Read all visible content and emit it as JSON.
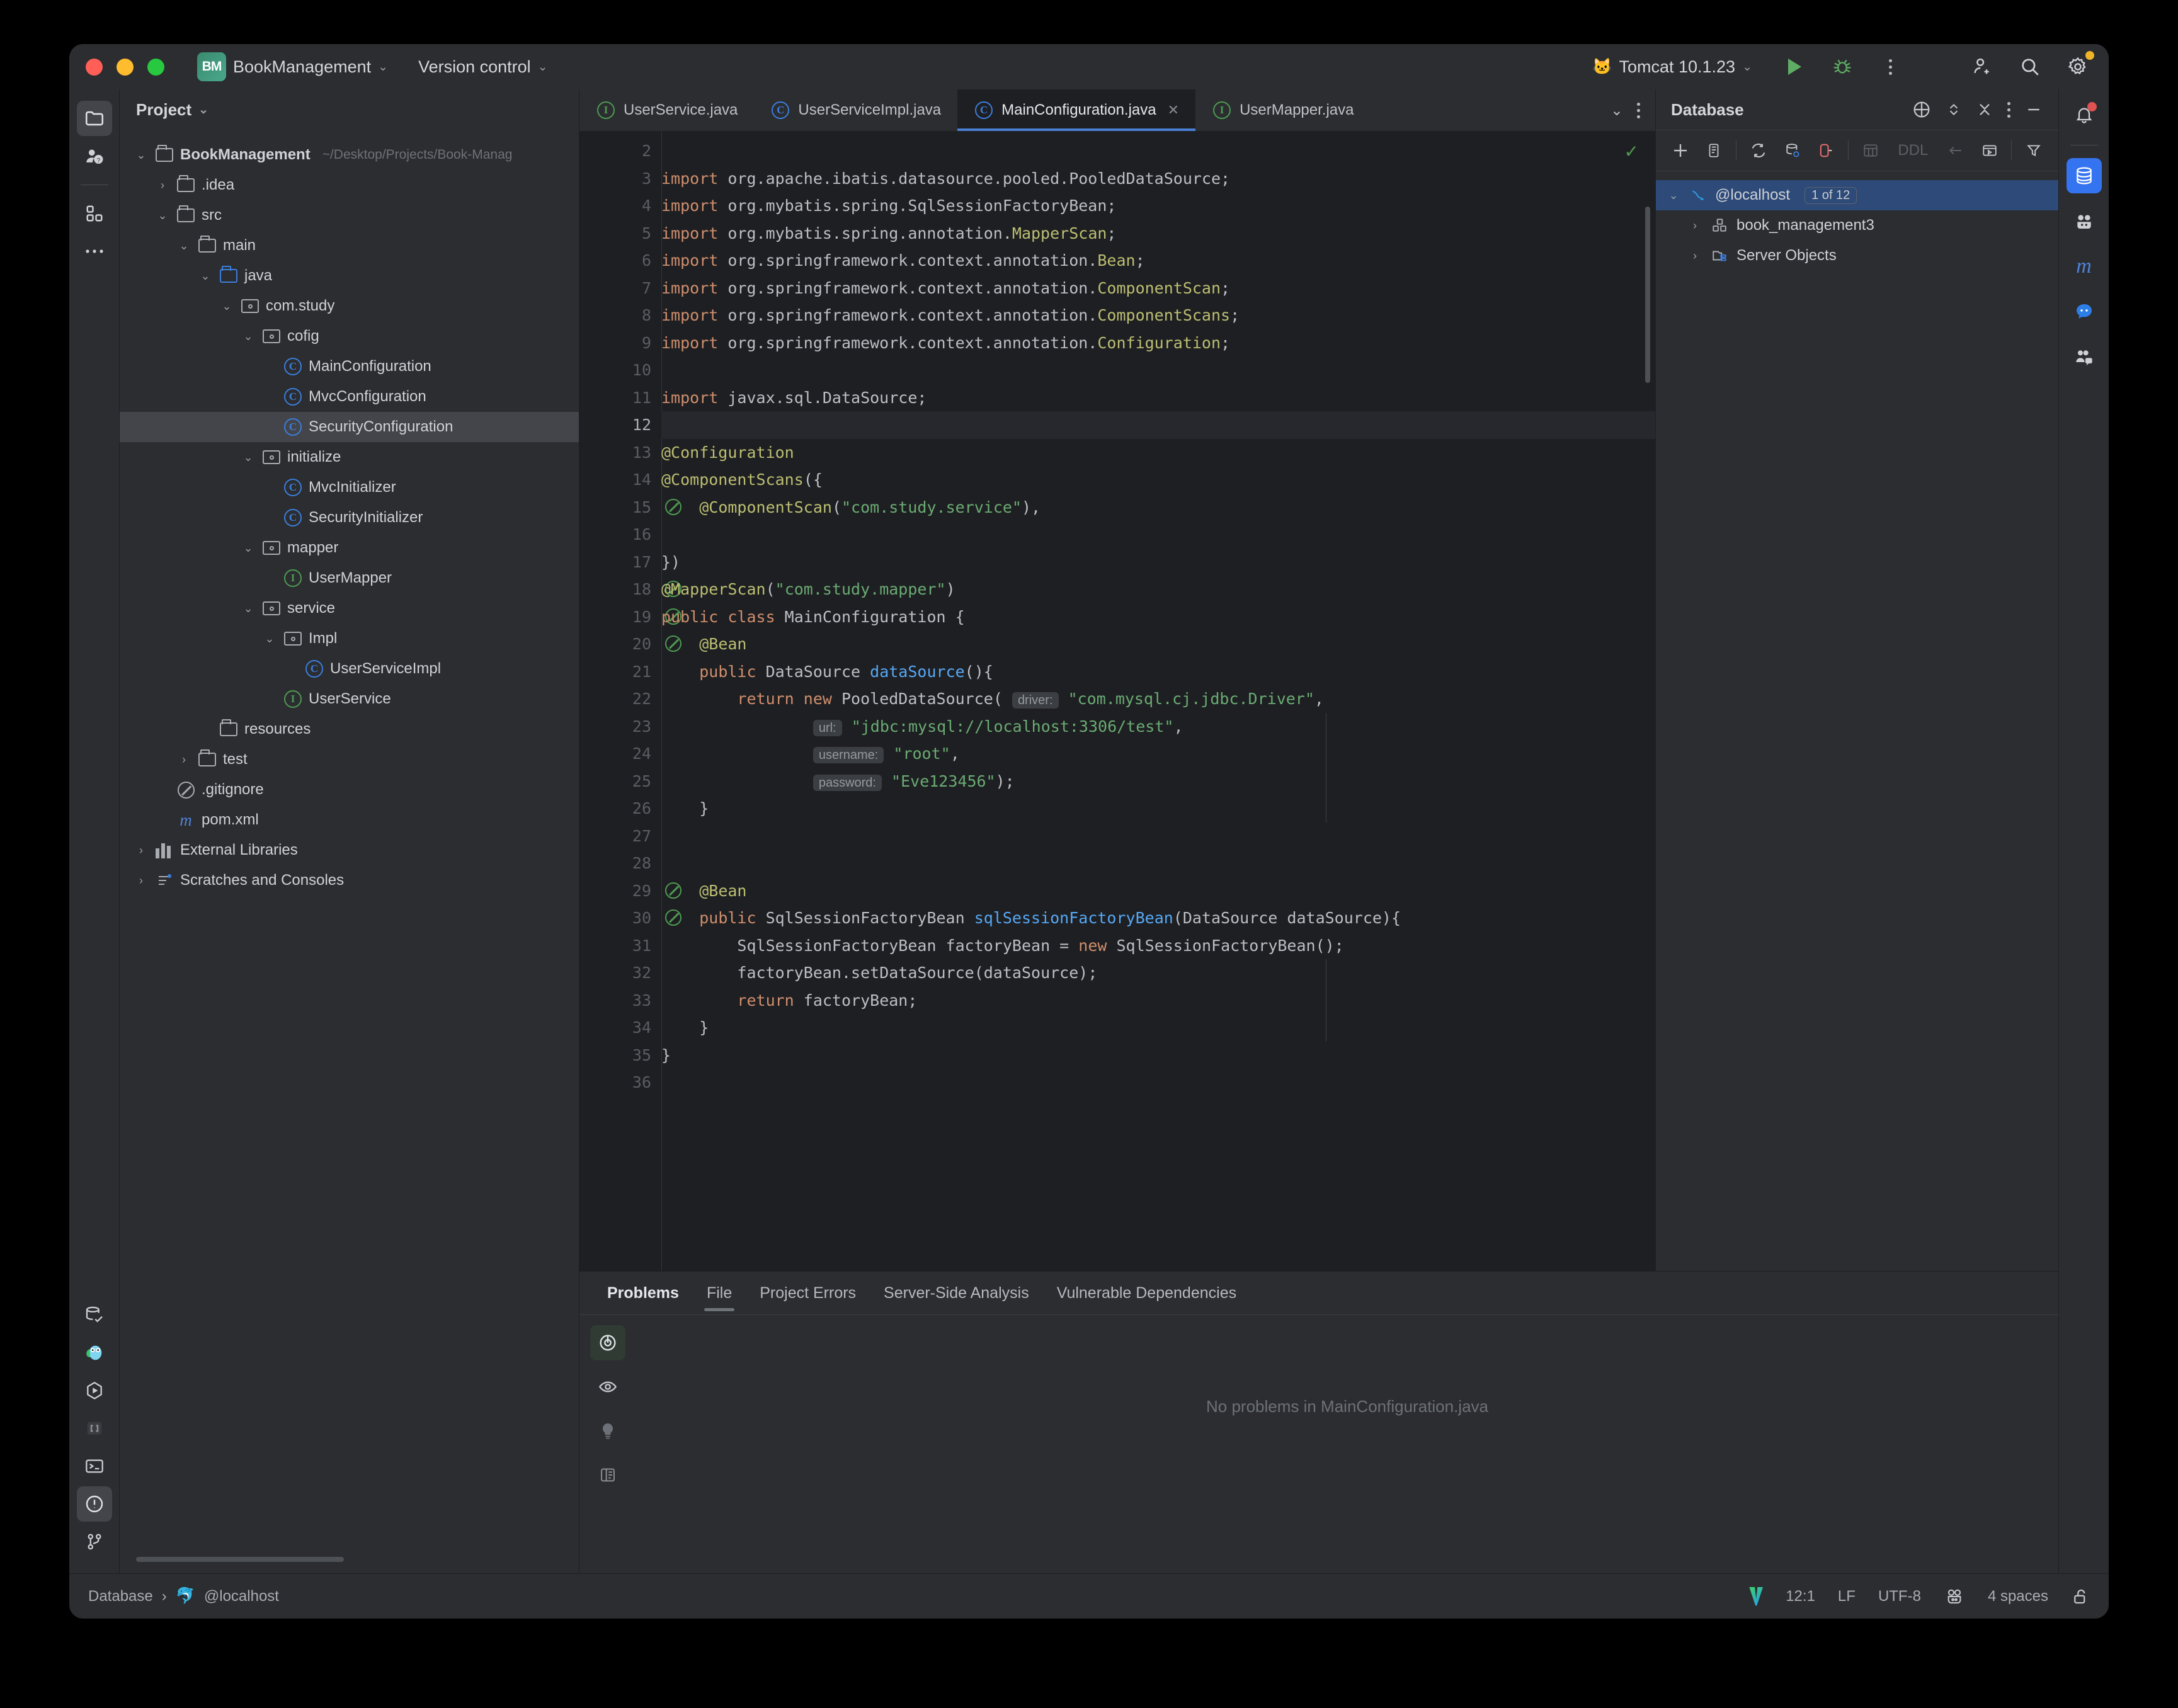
{
  "titlebar": {
    "project_badge": "BM",
    "project_name": "BookManagement",
    "version_control": "Version control",
    "run_config": "Tomcat 10.1.23",
    "icons": {
      "run": "run-icon",
      "debug": "debug-icon",
      "more": "more-options-icon",
      "add_user": "add-user-icon",
      "search": "search-icon",
      "settings": "settings-icon"
    }
  },
  "left_rail": {
    "top": [
      {
        "name": "project-tool-icon",
        "label": "Project"
      },
      {
        "name": "ai-assistant-icon",
        "label": "AI Assistant"
      },
      {
        "name": "structure-icon",
        "label": "Structure"
      },
      {
        "name": "more-tools-icon",
        "label": "More tools"
      }
    ],
    "bottom": [
      {
        "name": "database-check-icon",
        "label": "Database"
      },
      {
        "name": "go-gopher-icon",
        "label": "Gopher"
      },
      {
        "name": "run-hex-icon",
        "label": "Run"
      },
      {
        "name": "brackets-icon",
        "label": "Endpoints"
      },
      {
        "name": "terminal-icon",
        "label": "Terminal"
      },
      {
        "name": "problems-icon",
        "label": "Problems"
      },
      {
        "name": "git-branch-icon",
        "label": "Version Control"
      }
    ]
  },
  "right_rail": [
    {
      "name": "notifications-icon",
      "label": "Notifications"
    },
    {
      "name": "database-icon",
      "label": "Database"
    },
    {
      "name": "gradle-icon",
      "label": "Gradle"
    },
    {
      "name": "maven-icon",
      "label": "Maven"
    },
    {
      "name": "chat-icon",
      "label": "Chat"
    },
    {
      "name": "code-with-me-icon",
      "label": "Code With Me"
    }
  ],
  "project_panel": {
    "title": "Project",
    "tree": [
      {
        "depth": 0,
        "arrow": "down",
        "icon": "module-folder-icon",
        "label": "BookManagement",
        "bold": true,
        "suffix": "~/Desktop/Projects/Book-Manag"
      },
      {
        "depth": 1,
        "arrow": "right",
        "icon": "folder-icon",
        "label": ".idea"
      },
      {
        "depth": 1,
        "arrow": "down",
        "icon": "folder-icon",
        "label": "src"
      },
      {
        "depth": 2,
        "arrow": "down",
        "icon": "folder-icon",
        "label": "main"
      },
      {
        "depth": 3,
        "arrow": "down",
        "icon": "source-folder-icon",
        "label": "java"
      },
      {
        "depth": 4,
        "arrow": "down",
        "icon": "package-icon",
        "label": "com.study"
      },
      {
        "depth": 5,
        "arrow": "down",
        "icon": "package-icon",
        "label": "cofig"
      },
      {
        "depth": 6,
        "arrow": "none",
        "icon": "class-icon",
        "label": "MainConfiguration"
      },
      {
        "depth": 6,
        "arrow": "none",
        "icon": "class-icon",
        "label": "MvcConfiguration"
      },
      {
        "depth": 6,
        "arrow": "none",
        "icon": "class-icon",
        "label": "SecurityConfiguration",
        "selected": true
      },
      {
        "depth": 5,
        "arrow": "down",
        "icon": "package-icon",
        "label": "initialize"
      },
      {
        "depth": 6,
        "arrow": "none",
        "icon": "class-icon",
        "label": "MvcInitializer"
      },
      {
        "depth": 6,
        "arrow": "none",
        "icon": "class-icon",
        "label": "SecurityInitializer"
      },
      {
        "depth": 5,
        "arrow": "down",
        "icon": "package-icon",
        "label": "mapper"
      },
      {
        "depth": 6,
        "arrow": "none",
        "icon": "interface-icon",
        "label": "UserMapper"
      },
      {
        "depth": 5,
        "arrow": "down",
        "icon": "package-icon",
        "label": "service"
      },
      {
        "depth": 6,
        "arrow": "down",
        "icon": "package-icon",
        "label": "Impl"
      },
      {
        "depth": 7,
        "arrow": "none",
        "icon": "class-icon",
        "label": "UserServiceImpl"
      },
      {
        "depth": 6,
        "arrow": "none",
        "icon": "interface-icon",
        "label": "UserService"
      },
      {
        "depth": 3,
        "arrow": "none",
        "icon": "resources-folder-icon",
        "label": "resources"
      },
      {
        "depth": 2,
        "arrow": "right",
        "icon": "folder-icon",
        "label": "test"
      },
      {
        "depth": 1,
        "arrow": "none",
        "icon": "gitignore-icon",
        "label": ".gitignore"
      },
      {
        "depth": 1,
        "arrow": "none",
        "icon": "maven-icon",
        "label": "pom.xml"
      },
      {
        "depth": 0,
        "arrow": "right",
        "icon": "libraries-icon",
        "label": "External Libraries"
      },
      {
        "depth": 0,
        "arrow": "right",
        "icon": "scratches-icon",
        "label": "Scratches and Consoles"
      }
    ]
  },
  "editor": {
    "tabs": [
      {
        "label": "UserService.java",
        "icon": "interface-icon",
        "active": false
      },
      {
        "label": "UserServiceImpl.java",
        "icon": "class-icon",
        "active": false
      },
      {
        "label": "MainConfiguration.java",
        "icon": "class-icon",
        "active": true,
        "closable": true
      },
      {
        "label": "UserMapper.java",
        "icon": "interface-icon",
        "active": false
      }
    ],
    "tab_overflow_icon": "chevron-down-icon",
    "tab_options_icon": "more-options-icon",
    "inspection_status_icon": "no-errors-check-icon",
    "first_line_number": 2,
    "current_line": 12,
    "lines": [
      {
        "n": 2,
        "segments": []
      },
      {
        "n": 3,
        "segments": [
          {
            "t": "import ",
            "c": "k"
          },
          {
            "t": "org.apache.ibatis.datasource.pooled.PooledDataSource;",
            "c": "p"
          }
        ]
      },
      {
        "n": 4,
        "segments": [
          {
            "t": "import ",
            "c": "k"
          },
          {
            "t": "org.mybatis.spring.SqlSessionFactoryBean;",
            "c": "p"
          }
        ]
      },
      {
        "n": 5,
        "segments": [
          {
            "t": "import ",
            "c": "k"
          },
          {
            "t": "org.mybatis.spring.annotation.",
            "c": "p"
          },
          {
            "t": "MapperScan",
            "c": "a"
          },
          {
            "t": ";",
            "c": "p"
          }
        ]
      },
      {
        "n": 6,
        "segments": [
          {
            "t": "import ",
            "c": "k"
          },
          {
            "t": "org.springframework.context.annotation.",
            "c": "p"
          },
          {
            "t": "Bean",
            "c": "a"
          },
          {
            "t": ";",
            "c": "p"
          }
        ]
      },
      {
        "n": 7,
        "segments": [
          {
            "t": "import ",
            "c": "k"
          },
          {
            "t": "org.springframework.context.annotation.",
            "c": "p"
          },
          {
            "t": "ComponentScan",
            "c": "a"
          },
          {
            "t": ";",
            "c": "p"
          }
        ]
      },
      {
        "n": 8,
        "segments": [
          {
            "t": "import ",
            "c": "k"
          },
          {
            "t": "org.springframework.context.annotation.",
            "c": "p"
          },
          {
            "t": "ComponentScans",
            "c": "a"
          },
          {
            "t": ";",
            "c": "p"
          }
        ]
      },
      {
        "n": 9,
        "segments": [
          {
            "t": "import ",
            "c": "k"
          },
          {
            "t": "org.springframework.context.annotation.",
            "c": "p"
          },
          {
            "t": "Configuration",
            "c": "a"
          },
          {
            "t": ";",
            "c": "p"
          }
        ]
      },
      {
        "n": 10,
        "segments": []
      },
      {
        "n": 11,
        "segments": [
          {
            "t": "import ",
            "c": "k"
          },
          {
            "t": "javax.sql.DataSource;",
            "c": "p"
          }
        ]
      },
      {
        "n": 12,
        "segments": []
      },
      {
        "n": 13,
        "segments": [
          {
            "t": "@Configuration",
            "c": "a"
          }
        ]
      },
      {
        "n": 14,
        "segments": [
          {
            "t": "@ComponentScans",
            "c": "a"
          },
          {
            "t": "({",
            "c": "p"
          }
        ]
      },
      {
        "n": 15,
        "gutter_icon": "bean-search-icon",
        "segments": [
          {
            "t": "    ",
            "c": "p"
          },
          {
            "t": "@ComponentScan",
            "c": "a"
          },
          {
            "t": "(",
            "c": "p"
          },
          {
            "t": "\"com.study.service\"",
            "c": "s"
          },
          {
            "t": "),",
            "c": "p"
          }
        ]
      },
      {
        "n": 16,
        "segments": []
      },
      {
        "n": 17,
        "segments": [
          {
            "t": "})",
            "c": "p"
          }
        ]
      },
      {
        "n": 18,
        "gutter_icon": "bean-search-icon",
        "segments": [
          {
            "t": "@MapperScan",
            "c": "a"
          },
          {
            "t": "(",
            "c": "p"
          },
          {
            "t": "\"com.study.mapper\"",
            "c": "s"
          },
          {
            "t": ")",
            "c": "p"
          }
        ]
      },
      {
        "n": 19,
        "gutter_icon": "bean-icon",
        "segments": [
          {
            "t": "public class ",
            "c": "k"
          },
          {
            "t": "MainConfiguration {",
            "c": "p"
          }
        ]
      },
      {
        "n": 20,
        "gutter_icon": "bean-nav-icon",
        "segments": [
          {
            "t": "    ",
            "c": "p"
          },
          {
            "t": "@Bean",
            "c": "a"
          }
        ]
      },
      {
        "n": 21,
        "segments": [
          {
            "t": "    ",
            "c": "p"
          },
          {
            "t": "public ",
            "c": "k"
          },
          {
            "t": "DataSource ",
            "c": "p"
          },
          {
            "t": "dataSource",
            "c": "m"
          },
          {
            "t": "(){",
            "c": "p"
          }
        ]
      },
      {
        "n": 22,
        "segments": [
          {
            "t": "        ",
            "c": "p"
          },
          {
            "t": "return new ",
            "c": "k"
          },
          {
            "t": "PooledDataSource( ",
            "c": "p"
          },
          {
            "t": "driver:",
            "c": "hint"
          },
          {
            "t": " ",
            "c": "p"
          },
          {
            "t": "\"com.mysql.cj.jdbc.Driver\"",
            "c": "s"
          },
          {
            "t": ",",
            "c": "p"
          }
        ]
      },
      {
        "n": 23,
        "segments": [
          {
            "t": "                ",
            "c": "p"
          },
          {
            "t": "url:",
            "c": "hint"
          },
          {
            "t": " ",
            "c": "p"
          },
          {
            "t": "\"jdbc:mysql://localhost:3306/test\"",
            "c": "s"
          },
          {
            "t": ",",
            "c": "p"
          }
        ]
      },
      {
        "n": 24,
        "segments": [
          {
            "t": "                ",
            "c": "p"
          },
          {
            "t": "username:",
            "c": "hint"
          },
          {
            "t": " ",
            "c": "p"
          },
          {
            "t": "\"root\"",
            "c": "s"
          },
          {
            "t": ",",
            "c": "p"
          }
        ]
      },
      {
        "n": 25,
        "segments": [
          {
            "t": "                ",
            "c": "p"
          },
          {
            "t": "password:",
            "c": "hint"
          },
          {
            "t": " ",
            "c": "p"
          },
          {
            "t": "\"Eve123456\"",
            "c": "s"
          },
          {
            "t": ");",
            "c": "p"
          }
        ]
      },
      {
        "n": 26,
        "segments": [
          {
            "t": "    }",
            "c": "p"
          }
        ]
      },
      {
        "n": 27,
        "segments": []
      },
      {
        "n": 28,
        "segments": []
      },
      {
        "n": 29,
        "gutter_icon": "bean-nav-icon",
        "segments": [
          {
            "t": "    ",
            "c": "p"
          },
          {
            "t": "@Bean",
            "c": "a"
          }
        ]
      },
      {
        "n": 30,
        "gutter_icon": "bean-out-icon",
        "segments": [
          {
            "t": "    ",
            "c": "p"
          },
          {
            "t": "public ",
            "c": "k"
          },
          {
            "t": "SqlSessionFactoryBean ",
            "c": "p"
          },
          {
            "t": "sqlSessionFactoryBean",
            "c": "m"
          },
          {
            "t": "(DataSource dataSource){",
            "c": "p"
          }
        ]
      },
      {
        "n": 31,
        "segments": [
          {
            "t": "        ",
            "c": "p"
          },
          {
            "t": "SqlSessionFactoryBean factoryBean = ",
            "c": "p"
          },
          {
            "t": "new ",
            "c": "k"
          },
          {
            "t": "SqlSessionFactoryBean();",
            "c": "p"
          }
        ]
      },
      {
        "n": 32,
        "segments": [
          {
            "t": "        ",
            "c": "p"
          },
          {
            "t": "factoryBean.setDataSource(dataSource);",
            "c": "p"
          }
        ]
      },
      {
        "n": 33,
        "segments": [
          {
            "t": "        ",
            "c": "p"
          },
          {
            "t": "return ",
            "c": "k"
          },
          {
            "t": "factoryBean;",
            "c": "p"
          }
        ]
      },
      {
        "n": 34,
        "segments": [
          {
            "t": "    }",
            "c": "p"
          }
        ]
      },
      {
        "n": 35,
        "segments": [
          {
            "t": "}",
            "c": "p"
          }
        ]
      },
      {
        "n": 36,
        "segments": []
      }
    ]
  },
  "database_panel": {
    "title": "Database",
    "header_icons": [
      {
        "name": "locate-icon"
      },
      {
        "name": "expand-collapse-icon"
      },
      {
        "name": "collapse-all-icon"
      },
      {
        "name": "more-options-icon"
      },
      {
        "name": "minimize-icon"
      }
    ],
    "toolbar": [
      {
        "name": "add-data-source-icon",
        "label": "+"
      },
      {
        "name": "duplicate-icon",
        "label": ""
      },
      {
        "name": "refresh-icon",
        "label": ""
      },
      {
        "name": "database-settings-icon",
        "label": ""
      },
      {
        "name": "disconnect-icon",
        "label": ""
      },
      {
        "name": "table-icon",
        "label": "",
        "disabled": true
      },
      {
        "name": "ddl-icon",
        "label": "DDL",
        "disabled": true
      },
      {
        "name": "jump-to-icon",
        "label": "",
        "disabled": true
      },
      {
        "name": "console-icon",
        "label": ""
      },
      {
        "name": "filter-icon",
        "label": ""
      }
    ],
    "tree": [
      {
        "depth": 0,
        "arrow": "down",
        "icon": "mysql-icon",
        "label": "@localhost",
        "badge": "1 of 12",
        "selected": true
      },
      {
        "depth": 1,
        "arrow": "right",
        "icon": "schema-icon",
        "label": "book_management3"
      },
      {
        "depth": 1,
        "arrow": "right",
        "icon": "server-objects-icon",
        "label": "Server Objects"
      }
    ]
  },
  "problems_panel": {
    "tabs": [
      {
        "label": "Problems",
        "bold": true
      },
      {
        "label": "File",
        "active": true
      },
      {
        "label": "Project Errors"
      },
      {
        "label": "Server-Side Analysis"
      },
      {
        "label": "Vulnerable Dependencies"
      }
    ],
    "sidebar_icons": [
      {
        "name": "inspections-toggle-icon",
        "selected": true
      },
      {
        "name": "eye-preview-icon"
      },
      {
        "name": "lightbulb-icon"
      },
      {
        "name": "open-editor-preview-icon"
      }
    ],
    "empty_message": "No problems in MainConfiguration.java"
  },
  "status_bar": {
    "breadcrumb_root": "Database",
    "breadcrumb_sep": "›",
    "breadcrumb_leaf": "@localhost",
    "caret_position": "12:1",
    "line_separator": "LF",
    "encoding": "UTF-8",
    "indent": "4 spaces",
    "icons": [
      {
        "name": "intellij-v-icon"
      },
      {
        "name": "go-mascot-icon"
      },
      {
        "name": "lock-open-icon"
      }
    ]
  }
}
